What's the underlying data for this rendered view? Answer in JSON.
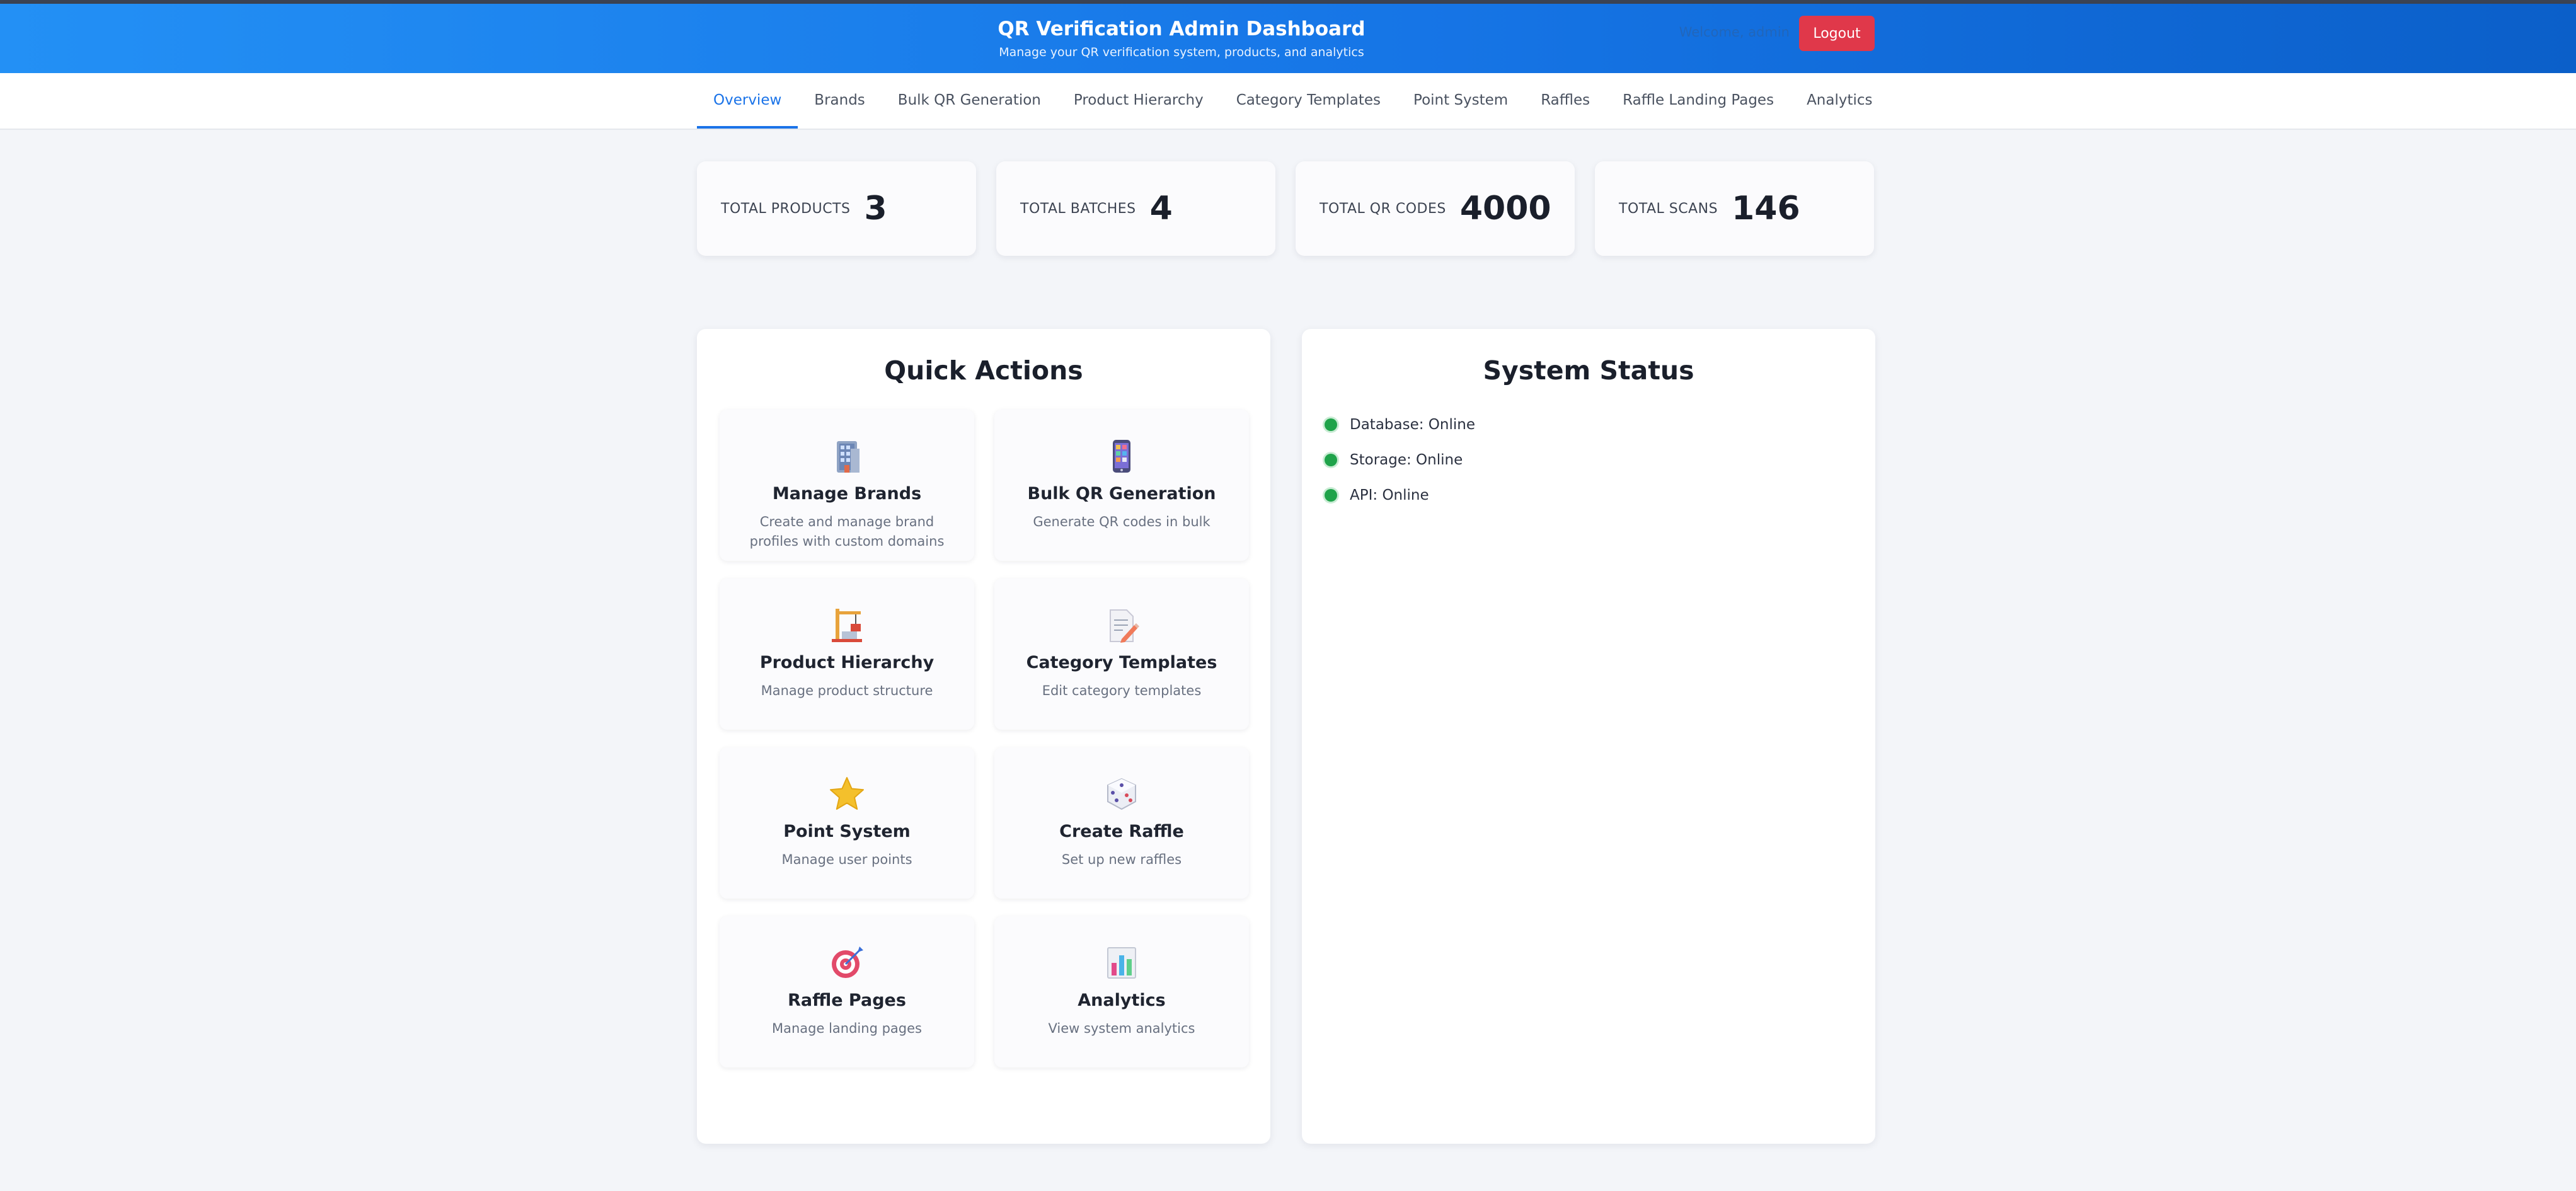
{
  "header": {
    "title": "QR Verification Admin Dashboard",
    "subtitle": "Manage your QR verification system, products, and analytics",
    "welcome": "Welcome, admin",
    "logout_label": "Logout",
    "accent": "#1a73e8",
    "logout_color": "#e0384a"
  },
  "tabs": [
    {
      "label": "Overview",
      "active": true
    },
    {
      "label": "Brands"
    },
    {
      "label": "Bulk QR Generation"
    },
    {
      "label": "Product Hierarchy"
    },
    {
      "label": "Category Templates"
    },
    {
      "label": "Point System"
    },
    {
      "label": "Raffles"
    },
    {
      "label": "Raffle Landing Pages"
    },
    {
      "label": "Analytics"
    }
  ],
  "stats": [
    {
      "label": "TOTAL PRODUCTS",
      "value": "3"
    },
    {
      "label": "TOTAL BATCHES",
      "value": "4"
    },
    {
      "label": "TOTAL QR CODES",
      "value": "4000"
    },
    {
      "label": "TOTAL SCANS",
      "value": "146"
    }
  ],
  "quick_actions": {
    "title": "Quick Actions",
    "items": [
      {
        "icon": "building-icon",
        "title": "Manage Brands",
        "desc": "Create and manage brand profiles with custom domains"
      },
      {
        "icon": "phone-icon",
        "title": "Bulk QR Generation",
        "desc": "Generate QR codes in bulk"
      },
      {
        "icon": "construction-icon",
        "title": "Product Hierarchy",
        "desc": "Manage product structure"
      },
      {
        "icon": "memo-icon",
        "title": "Category Templates",
        "desc": "Edit category templates"
      },
      {
        "icon": "star-icon",
        "title": "Point System",
        "desc": "Manage user points"
      },
      {
        "icon": "dice-icon",
        "title": "Create Raffle",
        "desc": "Set up new raffles"
      },
      {
        "icon": "target-icon",
        "title": "Raffle Pages",
        "desc": "Manage landing pages"
      },
      {
        "icon": "bar-chart-icon",
        "title": "Analytics",
        "desc": "View system analytics"
      }
    ]
  },
  "system_status": {
    "title": "System Status",
    "status_color": "#1fa34a",
    "items": [
      {
        "label": "Database: Online"
      },
      {
        "label": "Storage: Online"
      },
      {
        "label": "API: Online"
      }
    ]
  }
}
